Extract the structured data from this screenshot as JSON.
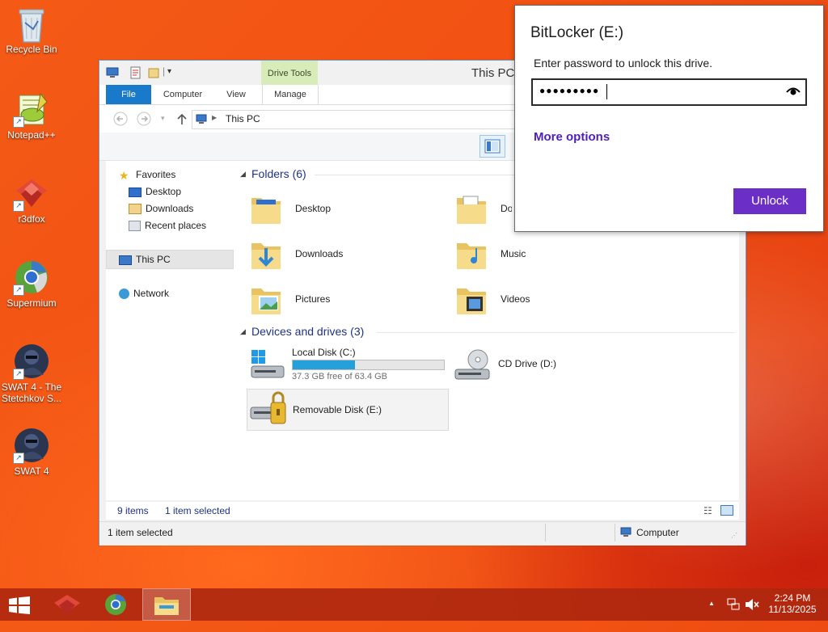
{
  "desktop": {
    "icons": [
      {
        "label_lines": [
          "Recycle Bin"
        ]
      },
      {
        "label_lines": [
          "Notepad++"
        ]
      },
      {
        "label_lines": [
          "r3dfox"
        ]
      },
      {
        "label_lines": [
          "Supermium"
        ]
      },
      {
        "label_lines": [
          "SWAT 4 - The",
          "Stetchkov S..."
        ]
      },
      {
        "label_lines": [
          "SWAT 4"
        ]
      }
    ]
  },
  "explorer": {
    "title": "This PC",
    "contextual_tab_group": "Drive Tools",
    "tabs": [
      "File",
      "Computer",
      "View",
      "Manage"
    ],
    "breadcrumb": "This PC",
    "nav": {
      "favorites": "Favorites",
      "favorites_items": [
        "Desktop",
        "Downloads",
        "Recent places"
      ],
      "this_pc": "This PC",
      "network": "Network"
    },
    "groups": {
      "folders": "Folders (6)",
      "devices": "Devices and drives (3)"
    },
    "folders": [
      "Desktop",
      "Documents",
      "Downloads",
      "Music",
      "Pictures",
      "Videos"
    ],
    "drives": {
      "local": {
        "name": "Local Disk (C:)",
        "free_text": "37.3 GB free of 63.4 GB",
        "used_fraction": 0.41
      },
      "cd": {
        "name": "CD Drive (D:)"
      },
      "removable": {
        "name": "Removable Disk (E:)"
      }
    },
    "status": {
      "items": "9 items",
      "selected": "1 item selected",
      "bottom_selected": "1 item selected",
      "location": "Computer"
    }
  },
  "bitlocker": {
    "title": "BitLocker (E:)",
    "prompt": "Enter password to unlock this drive.",
    "password_masked": "●●●●●●●●●",
    "more_options": "More options",
    "unlock": "Unlock",
    "accent": "#6b2fc7"
  },
  "taskbar": {
    "time": "2:24 PM",
    "date": "11/13/2025"
  }
}
